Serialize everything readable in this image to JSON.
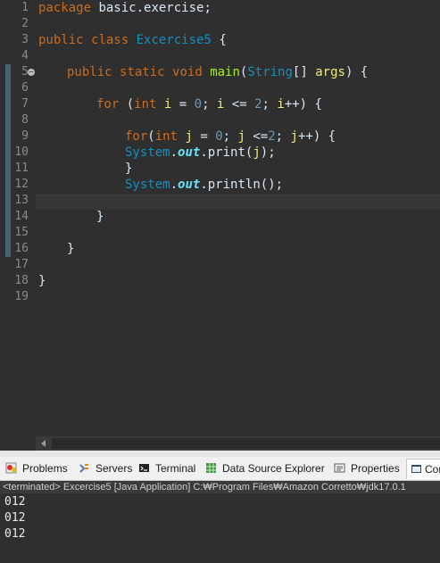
{
  "editor": {
    "line_numbers": [
      "1",
      "2",
      "3",
      "4",
      "5",
      "6",
      "7",
      "8",
      "9",
      "10",
      "11",
      "12",
      "13",
      "14",
      "15",
      "16",
      "17",
      "18",
      "19"
    ],
    "line1": {
      "kw": "package",
      "rest": " basic.exercise;"
    },
    "line3": {
      "kw1": "public",
      "kw2": "class",
      "cls": "Excercise5",
      "brace": " {"
    },
    "line5": {
      "kw1": "public",
      "kw2": "static",
      "kw3": "void",
      "mth": "main",
      "p1": "(",
      "cls": "String",
      "p2": "[] ",
      "var": "args",
      "p3": ") {"
    },
    "line7": {
      "kw": "for",
      "p1": " (",
      "kw2": "int",
      "sp": " ",
      "var1": "i",
      "p2": " = ",
      "n0": "0",
      "p3": "; ",
      "var2": "i",
      "p4": " <= ",
      "n2": "2",
      "p5": "; ",
      "var3": "i",
      "p6": "++) {"
    },
    "line9": {
      "kw": "for",
      "p1": "(",
      "kw2": "int",
      "sp": " ",
      "var1": "j",
      "p2": " = ",
      "n0": "0",
      "p3": "; ",
      "var2": "j",
      "p4": " <=",
      "n2": "2",
      "p5": "; ",
      "var3": "j",
      "p6": "++) {"
    },
    "line10": {
      "cls": "System",
      "dot1": ".",
      "fld": "out",
      "dot2": ".",
      "mth": "print",
      "p1": "(",
      "var": "j",
      "p2": ");"
    },
    "line11": {
      "brace": "}"
    },
    "line12": {
      "cls": "System",
      "dot1": ".",
      "fld": "out",
      "dot2": ".",
      "mth": "println",
      "p1": "();"
    },
    "line14": {
      "brace": "}"
    },
    "line16": {
      "brace": "}"
    },
    "line18": {
      "brace": "}"
    }
  },
  "tabs": [
    {
      "label": "Problems",
      "icon": "problems-icon"
    },
    {
      "label": "Servers",
      "icon": "servers-icon"
    },
    {
      "label": "Terminal",
      "icon": "terminal-icon"
    },
    {
      "label": "Data Source Explorer",
      "icon": "data-source-explorer-icon"
    },
    {
      "label": "Properties",
      "icon": "properties-icon"
    },
    {
      "label": "Cor",
      "icon": "console-icon"
    }
  ],
  "console": {
    "header": "<terminated> Excercise5 [Java Application] C:₩Program Files₩Amazon Corretto₩jdk17.0.1",
    "output": [
      "012",
      "012",
      "012"
    ]
  }
}
